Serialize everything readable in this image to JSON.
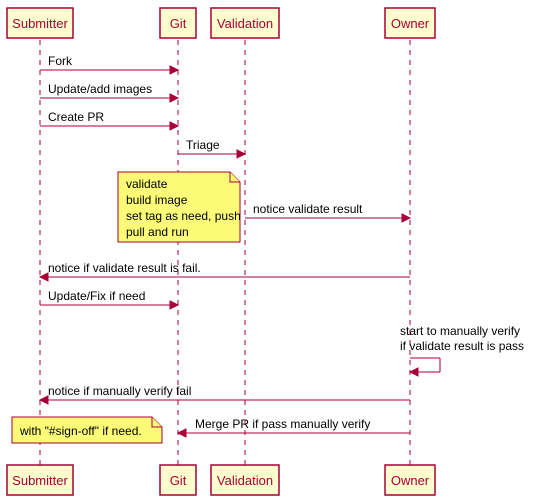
{
  "participants": {
    "submitter": "Submitter",
    "git": "Git",
    "validation": "Validation",
    "owner": "Owner"
  },
  "messages": {
    "fork": "Fork",
    "update_add_images": "Update/add images",
    "create_pr": "Create PR",
    "triage": "Triage",
    "notice_validate_result": "notice validate result",
    "notice_fail": "notice if validate result is fail.",
    "update_fix": "Update/Fix if need",
    "start_manual_1": "start to manually verify",
    "start_manual_2": "if validate result is pass",
    "notice_manual_fail": "notice if manually verify fail",
    "merge_pr": "Merge PR if pass manually verify"
  },
  "notes": {
    "validate_1": "validate",
    "validate_2": "build image",
    "validate_3": "set tag as need, push",
    "validate_4": "pull and run",
    "signoff": "with \"#sign-off\" if need."
  },
  "chart_data": {
    "type": "sequence",
    "participants": [
      "Submitter",
      "Git",
      "Validation",
      "Owner"
    ],
    "events": [
      {
        "from": "Submitter",
        "to": "Git",
        "label": "Fork"
      },
      {
        "from": "Submitter",
        "to": "Git",
        "label": "Update/add images"
      },
      {
        "from": "Submitter",
        "to": "Git",
        "label": "Create PR"
      },
      {
        "from": "Git",
        "to": "Validation",
        "label": "Triage"
      },
      {
        "note_over": [
          "Git"
        ],
        "text": "validate\nbuild image\nset tag as need, push\npull and run"
      },
      {
        "from": "Validation",
        "to": "Owner",
        "label": "notice validate result"
      },
      {
        "from": "Owner",
        "to": "Submitter",
        "label": "notice if validate result is fail."
      },
      {
        "from": "Submitter",
        "to": "Git",
        "label": "Update/Fix if need"
      },
      {
        "from": "Owner",
        "to": "Owner",
        "label": "start to manually verify\nif validate result is pass"
      },
      {
        "from": "Owner",
        "to": "Submitter",
        "label": "notice if manually verify fail"
      },
      {
        "note_over": [
          "Submitter"
        ],
        "text": "with \"#sign-off\" if need."
      },
      {
        "from": "Owner",
        "to": "Git",
        "label": "Merge PR if pass manually verify"
      }
    ]
  }
}
